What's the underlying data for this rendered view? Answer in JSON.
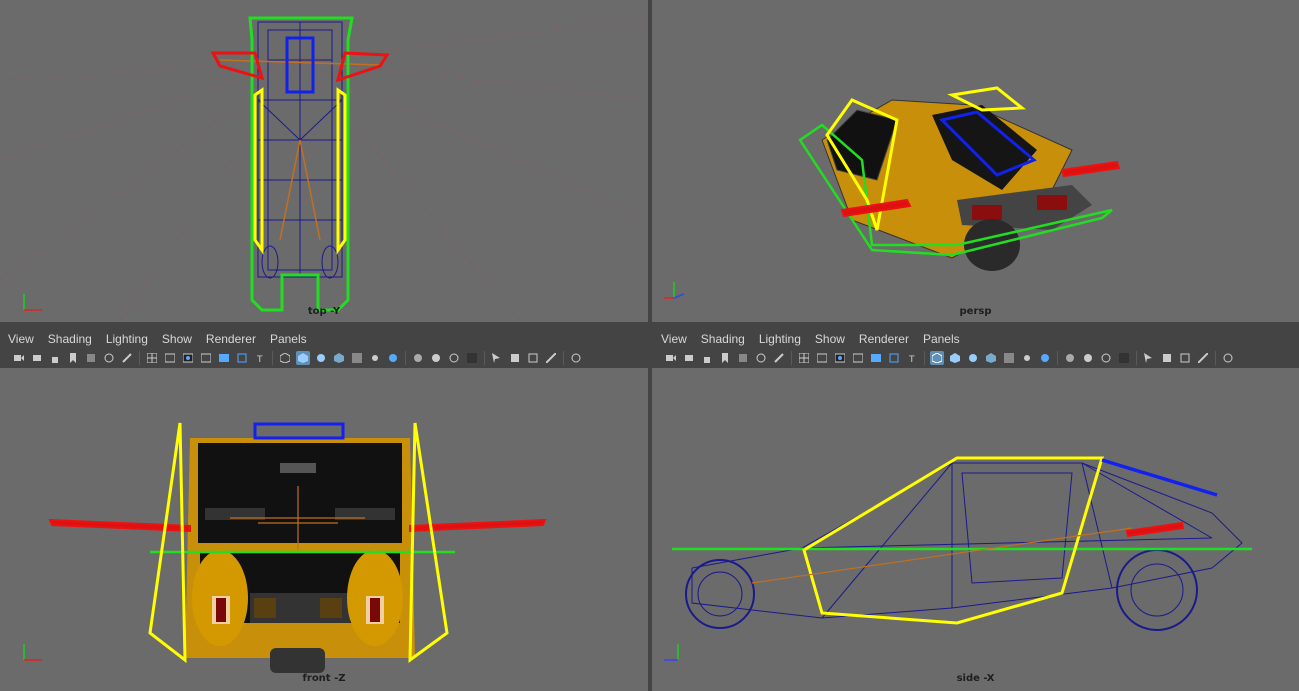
{
  "viewports": {
    "top_left": {
      "label": "top -Y"
    },
    "top_right": {
      "label": "persp"
    },
    "bottom_left": {
      "label": "front -Z"
    },
    "bottom_right": {
      "label": "side -X"
    }
  },
  "panel_menu": {
    "left": [
      "View",
      "Shading",
      "Lighting",
      "Show",
      "Renderer",
      "Panels"
    ],
    "right": [
      "View",
      "Shading",
      "Lighting",
      "Show",
      "Renderer",
      "Panels"
    ]
  },
  "colors": {
    "viewport_bg": "#6b6b6b",
    "grid": "#7a5a5a",
    "wireframe": "#1a1a8c",
    "body": "#c8900a",
    "yellow_ctrl": "#ffff00",
    "green_ctrl": "#22dd22",
    "red_ctrl": "#ee1111",
    "blue_ctrl": "#1122ee"
  },
  "icons": [
    "camera-icon",
    "select-camera-icon",
    "lock-camera-icon",
    "bookmark-icon",
    "image-plane-icon",
    "2d-pan-icon",
    "grease-pencil-icon",
    "grid-icon",
    "film-gate-icon",
    "resolution-gate-icon",
    "gate-mask-icon",
    "field-chart-icon",
    "safe-action-icon",
    "safe-title-icon",
    "wireframe-icon",
    "smooth-shade-icon",
    "default-material-icon",
    "textured-icon",
    "use-lights-icon",
    "shadows-icon",
    "ambient-occlusion-icon",
    "motion-blur-icon",
    "anti-aliasing-icon",
    "depth-of-field-icon",
    "isolate-select-icon",
    "xray-icon",
    "xray-joints-icon",
    "xray-components-icon",
    "backface-culling-icon"
  ]
}
